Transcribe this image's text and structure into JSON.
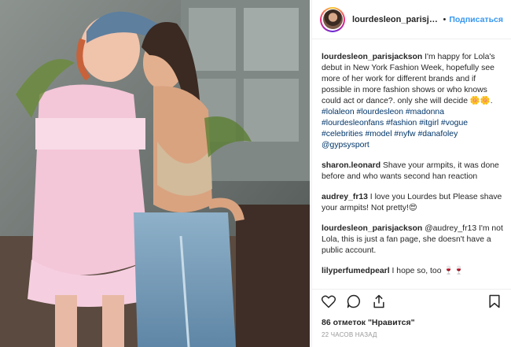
{
  "header": {
    "username": "lourdesleon_parisjac...",
    "separator": "•",
    "follow_label": "Подписаться"
  },
  "comments": [
    {
      "user": "lourdesleon_parisjackson",
      "text": " I'm happy for Lola's debut in New York Fashion Week, hopefully see more of her work for different brands and if possible in more fashion shows or who knows could act or dance?. only she will decide 🌼🌼.",
      "tags": "#lolaleon #lourdesleon #madonna #lourdesleonfans #fashion #itgirl #vogue #celebrities #model #nyfw #danafoley @gypsysport"
    },
    {
      "user": "sharon.leonard",
      "text": " Shave your armpits, it was done before and who wants second han reaction"
    },
    {
      "user": "audrey_fr13",
      "text": " I love you Lourdes but Please shave your armpits! Not pretty!😍"
    },
    {
      "user": "lourdesleon_parisjackson",
      "text": " @audrey_fr13 I'm not Lola, this is just a fan page, she doesn't have a public account."
    },
    {
      "user": "lilyperfumedpearl",
      "text": " I hope so, too 🍷🍷"
    }
  ],
  "actions": {
    "like_icon": "heart-icon",
    "comment_icon": "comment-icon",
    "share_icon": "share-icon",
    "save_icon": "bookmark-icon"
  },
  "likes_text": "86 отметок \"Нравится\"",
  "timestamp": "22 ЧАСОВ НАЗАД",
  "colors": {
    "link": "#003569",
    "follow": "#3897f0",
    "text": "#262626",
    "muted": "#999999"
  }
}
